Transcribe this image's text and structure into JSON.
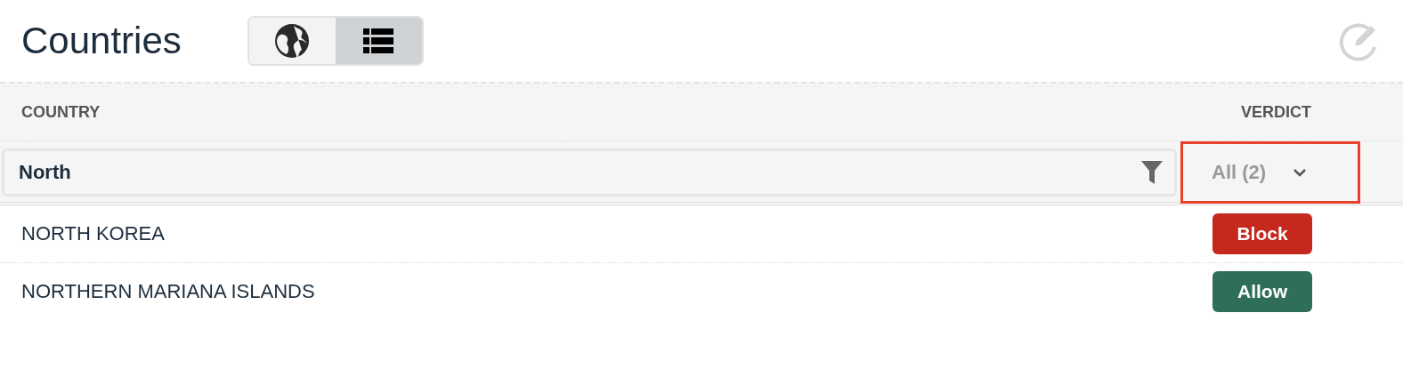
{
  "title": "Countries",
  "view_toggle": [
    {
      "kind": "globe",
      "selected": false
    },
    {
      "kind": "list",
      "selected": true
    }
  ],
  "table": {
    "columns": [
      "COUNTRY",
      "VERDICT"
    ],
    "filter": {
      "value": "North",
      "verdict_select": "All (2)",
      "highlighted": true
    },
    "rows": [
      {
        "country": "NORTH KOREA",
        "verdict": "Block",
        "color": "#c5281c"
      },
      {
        "country": "NORTHERN MARIANA ISLANDS",
        "verdict": "Allow",
        "color": "#2e6e5a"
      }
    ]
  }
}
